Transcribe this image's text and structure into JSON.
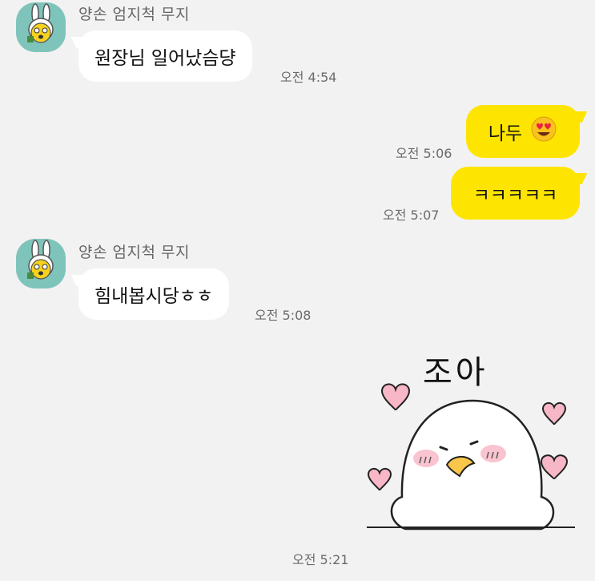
{
  "messages": [
    {
      "sender": "양손 엄지척 무지",
      "text": "원장님 일어났슴댱",
      "time": "오전 4:54"
    },
    {
      "text": "나두",
      "emoji": "😍",
      "time": "오전 5:06"
    },
    {
      "text": "ㅋㅋㅋㅋㅋ",
      "time": "오전 5:07"
    },
    {
      "sender": "양손 엄지척 무지",
      "text": "힘내봅시당ㅎㅎ",
      "time": "오전 5:08"
    },
    {
      "sticker_text": "조아",
      "time": "오전 5:21"
    }
  ],
  "icons": {
    "avatar": "muzi-thumbs-up-avatar",
    "emoji": "heart-eyes-emoji",
    "sticker": "heart-sticker"
  },
  "colors": {
    "background": "#f2f2f2",
    "incoming_bubble": "#ffffff",
    "outgoing_bubble": "#fde501",
    "avatar_bg": "#7fc4bb",
    "heart": "#f7b7c6"
  }
}
